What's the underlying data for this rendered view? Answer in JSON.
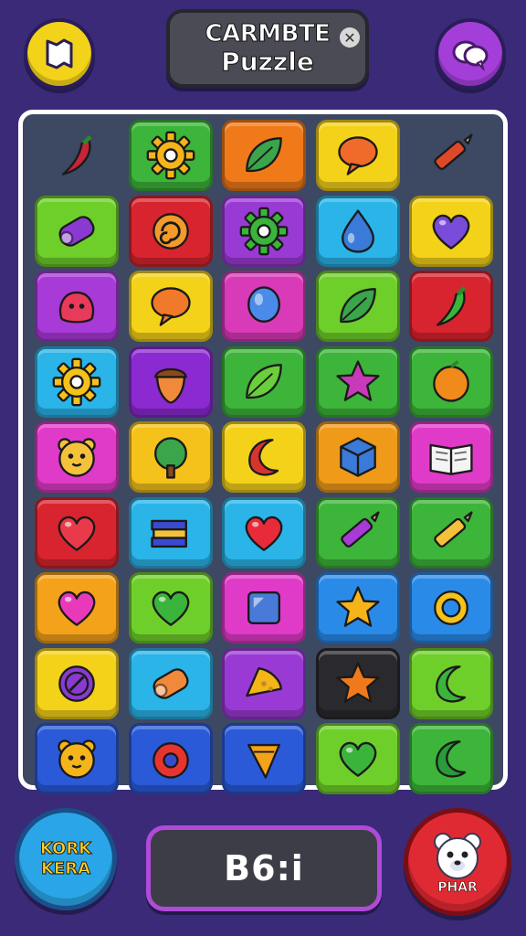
{
  "header": {
    "title_line1": "CARMBTE",
    "title_line2": "Puzzle",
    "close_glyph": "✕",
    "left_button_icon": "map-icon",
    "right_button_icon": "chat-bubbles-icon"
  },
  "board": {
    "rows": [
      [
        {
          "color": "",
          "icon": "chili-pepper-icon",
          "fill": "#c9243a"
        },
        {
          "color": "#3db43a",
          "icon": "gear-icon",
          "fill": "#f4b41a"
        },
        {
          "color": "#f07a1a",
          "icon": "leaf-icon",
          "fill": "#3aa54a"
        },
        {
          "color": "#f4d21a",
          "icon": "speech-bubble-icon",
          "fill": "#f06a2a"
        },
        {
          "color": "",
          "icon": "crayon-icon",
          "fill": "#e0482a"
        }
      ],
      [
        {
          "color": "#6fcf2a",
          "icon": "barrel-icon",
          "fill": "#8a3ad0"
        },
        {
          "color": "#d8242e",
          "icon": "swirl-icon",
          "fill": "#f49a2a"
        },
        {
          "color": "#9a3ad4",
          "icon": "gear-icon",
          "fill": "#3ab43a"
        },
        {
          "color": "#2ab4e8",
          "icon": "droplet-icon",
          "fill": "#3a7ad8"
        },
        {
          "color": "#f4d21a",
          "icon": "heart-icon",
          "fill": "#7a4ad8"
        }
      ],
      [
        {
          "color": "#a83ad8",
          "icon": "blob-creature-icon",
          "fill": "#e83a5a"
        },
        {
          "color": "#f4d21a",
          "icon": "speech-bubble-icon",
          "fill": "#f07a2a"
        },
        {
          "color": "#d83ab8",
          "icon": "balloon-icon",
          "fill": "#4a8ae8"
        },
        {
          "color": "#6fcf2a",
          "icon": "leaves-icon",
          "fill": "#3aa54a"
        },
        {
          "color": "#d8242e",
          "icon": "chili-pepper-icon",
          "fill": "#3ab43a"
        }
      ],
      [
        {
          "color": "#2ab4e8",
          "icon": "gear-icon",
          "fill": "#f4c21a"
        },
        {
          "color": "#8a2ad0",
          "icon": "acorn-icon",
          "fill": "#f08a3a"
        },
        {
          "color": "#3db43a",
          "icon": "leaf-icon",
          "fill": "#6acf3a"
        },
        {
          "color": "#3db43a",
          "icon": "star-icon",
          "fill": "#c83ab8"
        },
        {
          "color": "#3db43a",
          "icon": "orange-icon",
          "fill": "#f08a1a"
        }
      ],
      [
        {
          "color": "#e03ac8",
          "icon": "bear-face-icon",
          "fill": "#f4c23a"
        },
        {
          "color": "#f4c21a",
          "icon": "tree-icon",
          "fill": "#3aa54a"
        },
        {
          "color": "#f4d21a",
          "icon": "crescent-icon",
          "fill": "#d8342e"
        },
        {
          "color": "#f09a1a",
          "icon": "cube-icon",
          "fill": "#3a7ad8"
        },
        {
          "color": "#e03ac8",
          "icon": "open-book-icon",
          "fill": "#f4f4f4"
        }
      ],
      [
        {
          "color": "#d8242e",
          "icon": "heart-icon",
          "fill": "#e83a4a"
        },
        {
          "color": "#2ab4e8",
          "icon": "books-icon",
          "fill": "#3a4ad0"
        },
        {
          "color": "#2ab4e8",
          "icon": "heart-icon",
          "fill": "#e82a3a"
        },
        {
          "color": "#3db43a",
          "icon": "crayon-icon",
          "fill": "#a83ad8"
        },
        {
          "color": "#3db43a",
          "icon": "pencil-icon",
          "fill": "#f4c23a"
        }
      ],
      [
        {
          "color": "#f4a21a",
          "icon": "heart-icon",
          "fill": "#e83ab8"
        },
        {
          "color": "#6fcf2a",
          "icon": "heart-icon",
          "fill": "#3ab43a"
        },
        {
          "color": "#e03ac8",
          "icon": "square-gem-icon",
          "fill": "#4a7ad8"
        },
        {
          "color": "#2a8ae8",
          "icon": "star-icon",
          "fill": "#f4b41a"
        },
        {
          "color": "#2a8ae8",
          "icon": "ring-icon",
          "fill": "#f4c21a"
        }
      ],
      [
        {
          "color": "#f4d21a",
          "icon": "circle-badge-icon",
          "fill": "#8a3ad0"
        },
        {
          "color": "#2ab4e8",
          "icon": "log-icon",
          "fill": "#f08a3a"
        },
        {
          "color": "#9a3ad4",
          "icon": "cheese-icon",
          "fill": "#f4b41a"
        },
        {
          "color": "#2a2a2e",
          "icon": "star-icon",
          "fill": "#f07a1a"
        },
        {
          "color": "#6fcf2a",
          "icon": "crescent-icon",
          "fill": "#3ab43a"
        }
      ],
      [
        {
          "color": "#2a5ad8",
          "icon": "cat-face-icon",
          "fill": "#f4b41a"
        },
        {
          "color": "#2a5ad8",
          "icon": "donut-icon",
          "fill": "#e8342e"
        },
        {
          "color": "#2a5ad8",
          "icon": "cone-icon",
          "fill": "#f4a21a"
        },
        {
          "color": "#6fcf2a",
          "icon": "heart-icon",
          "fill": "#3ab43a"
        },
        {
          "color": "#3db43a",
          "icon": "crescent-icon",
          "fill": "#2a9a3a"
        }
      ]
    ]
  },
  "footer": {
    "left_button_line1": "KORK",
    "left_button_line2": "KERA",
    "score": "B6:i",
    "right_button_label": "PHAR",
    "right_button_icon": "bear-face-icon"
  },
  "colors": {
    "background": "#3a2a78",
    "board": "#3d4863",
    "score_border": "#b04ad8"
  }
}
